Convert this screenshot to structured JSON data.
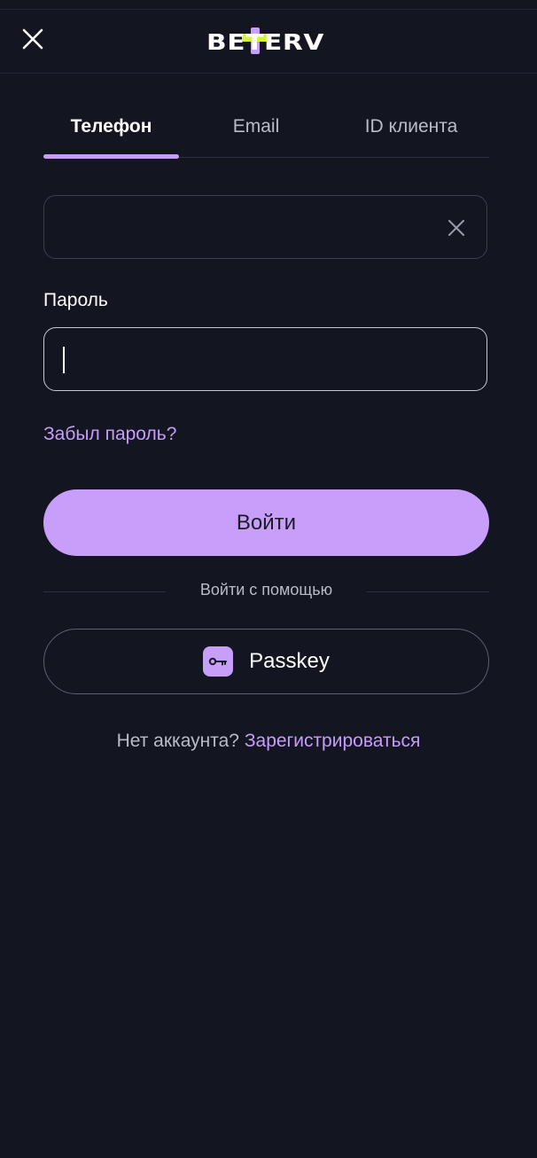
{
  "header": {
    "logo_text": "BETERV",
    "close_icon": "close-icon"
  },
  "tabs": [
    {
      "label": "Телефон",
      "active": true
    },
    {
      "label": "Email",
      "active": false
    },
    {
      "label": "ID клиента",
      "active": false
    }
  ],
  "phone_field": {
    "value": "",
    "clear_icon": "clear-icon"
  },
  "password_field": {
    "label": "Пароль",
    "value": ""
  },
  "forgot_password": "Забыл пароль?",
  "login_button": "Войти",
  "divider_text": "Войти с помощью",
  "passkey_button": {
    "label": "Passkey",
    "icon": "key-icon"
  },
  "signup": {
    "prompt": "Нет аккаунта?",
    "link": "Зарегистрироваться"
  },
  "colors": {
    "background": "#131520",
    "accent": "#c89efb",
    "logo_accent": "#d2f53c",
    "muted_text": "#b9bcc7"
  }
}
